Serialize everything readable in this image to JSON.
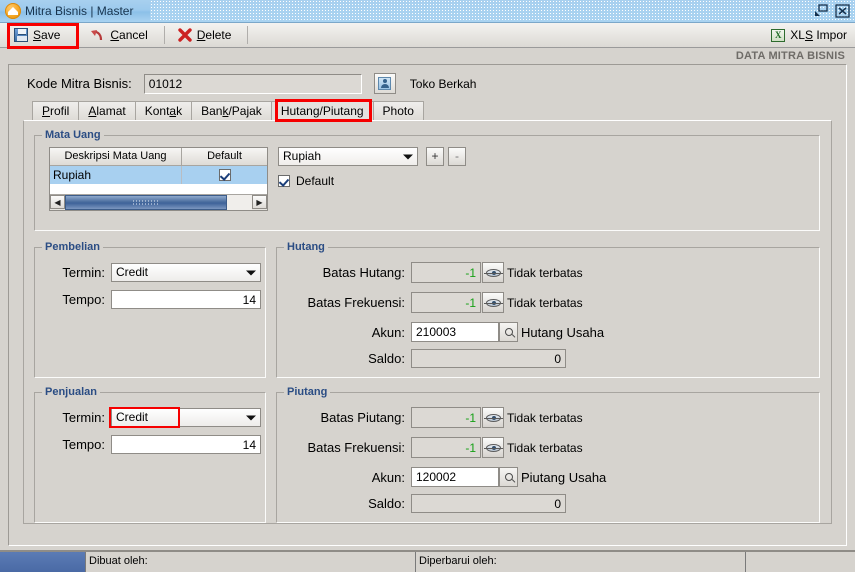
{
  "window": {
    "title": "Mitra Bisnis | Master",
    "app_icon": "orange-circle-icon",
    "restore_label": "restore-icon",
    "close_label": "close-icon"
  },
  "toolbar": {
    "save": {
      "prefix": "",
      "mnemonic": "S",
      "suffix": "ave",
      "label": "Save",
      "icon": "save-disk-icon"
    },
    "cancel": {
      "mnemonic": "C",
      "suffix": "ancel",
      "label": "Cancel",
      "icon": "undo-arrow-icon"
    },
    "delete": {
      "mnemonic": "D",
      "suffix": "elete",
      "label": "Delete",
      "icon": "red-x-icon"
    },
    "xls_impor": {
      "pre": "XL",
      "mnemonic": "S",
      "post": " Impor",
      "label": "XLS Impor",
      "icon": "excel-icon"
    }
  },
  "subheader": {
    "title": "DATA MITRA BISNIS"
  },
  "form": {
    "kode_label": "Kode Mitra Bisnis:",
    "kode_value": "01012",
    "kode_placeholder": "",
    "person_button_icon": "contact-card-icon",
    "partner_name": "Toko Berkah"
  },
  "tabs": [
    {
      "label": "Profil",
      "mnemonic_index": 0,
      "active": false
    },
    {
      "label": "Alamat",
      "mnemonic_index": 0,
      "active": false
    },
    {
      "label": "Kontak",
      "mnemonic_index": 4,
      "active": false
    },
    {
      "label": "Bank/Pajak",
      "mnemonic_index": 3,
      "active": false
    },
    {
      "label": "Hutang/Piutang",
      "mnemonic_index": -1,
      "active": true
    },
    {
      "label": "Photo",
      "mnemonic_index": -1,
      "active": false
    }
  ],
  "mata_uang": {
    "legend": "Mata Uang",
    "columns": [
      "Deskripsi Mata Uang",
      "Default"
    ],
    "rows": [
      {
        "deskripsi": "Rupiah",
        "default": true,
        "selected": true
      }
    ],
    "combo_value": "Rupiah",
    "add_button": "+",
    "remove_button": "-",
    "default_checkbox_label": "Default",
    "default_checked": true
  },
  "pembelian": {
    "legend": "Pembelian",
    "termin_label": "Termin:",
    "termin_value": "Credit",
    "tempo_label": "Tempo:",
    "tempo_value": "14"
  },
  "penjualan": {
    "legend": "Penjualan",
    "termin_label": "Termin:",
    "termin_value": "Credit",
    "tempo_label": "Tempo:",
    "tempo_value": "14",
    "termin_highlighted": true
  },
  "hutang": {
    "legend": "Hutang",
    "batas_label": "Batas Hutang:",
    "batas_value": "-1",
    "batas_note": "Tidak terbatas",
    "frekuensi_label": "Batas Frekuensi:",
    "frekuensi_value": "-1",
    "frekuensi_note": "Tidak terbatas",
    "akun_label": "Akun:",
    "akun_value": "210003",
    "akun_name": "Hutang Usaha",
    "saldo_label": "Saldo:",
    "saldo_value": "0"
  },
  "piutang": {
    "legend": "Piutang",
    "batas_label": "Batas Piutang:",
    "batas_value": "-1",
    "batas_note": "Tidak terbatas",
    "frekuensi_label": "Batas Frekuensi:",
    "frekuensi_value": "-1",
    "frekuensi_note": "Tidak terbatas",
    "akun_label": "Akun:",
    "akun_value": "120002",
    "akun_name": "Piutang Usaha",
    "saldo_label": "Saldo:",
    "saldo_value": "0"
  },
  "statusbar": {
    "created_label": "Dibuat oleh:",
    "created_value": "",
    "updated_label": "Diperbarui oleh:",
    "updated_value": ""
  },
  "colors": {
    "highlight_red": "#f60000",
    "title_blue": "#a8d0ef",
    "selection_blue": "#a8d0f0",
    "legend_blue": "#2b4d84",
    "negative_green": "#15a015",
    "face": "#d6d3ce"
  }
}
